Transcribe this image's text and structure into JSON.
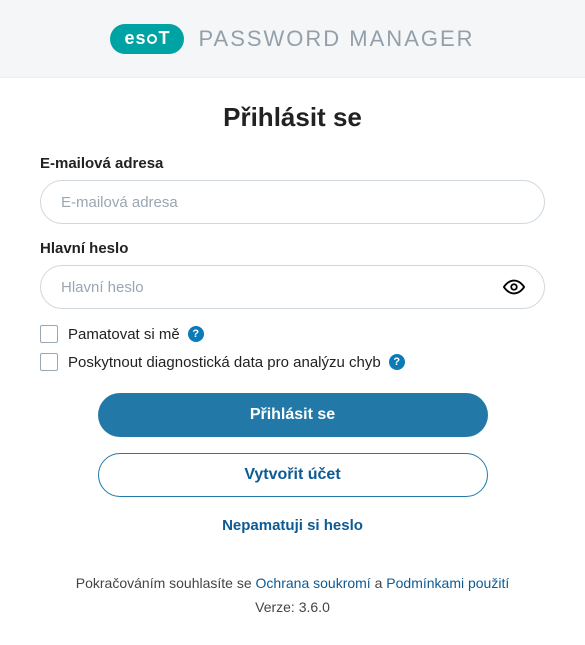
{
  "brand": {
    "logo_text": "eset",
    "app_name": "PASSWORD MANAGER"
  },
  "title": "Přihlásit se",
  "fields": {
    "email": {
      "label": "E-mailová adresa",
      "placeholder": "E-mailová adresa",
      "value": ""
    },
    "password": {
      "label": "Hlavní heslo",
      "placeholder": "Hlavní heslo",
      "value": ""
    }
  },
  "checkboxes": {
    "remember": {
      "label": "Pamatovat si mě",
      "checked": false
    },
    "diagnostics": {
      "label": "Poskytnout diagnostická data pro analýzu chyb",
      "checked": false
    }
  },
  "help_glyph": "?",
  "buttons": {
    "login": "Přihlásit se",
    "create_account": "Vytvořit účet"
  },
  "links": {
    "forgot_password": "Nepamatuji si heslo"
  },
  "footer": {
    "prefix": "Pokračováním souhlasíte se ",
    "privacy": "Ochrana soukromí",
    "mid": " a ",
    "terms": "Podmínkami použití",
    "version_label": "Verze: ",
    "version_value": "3.6.0"
  }
}
